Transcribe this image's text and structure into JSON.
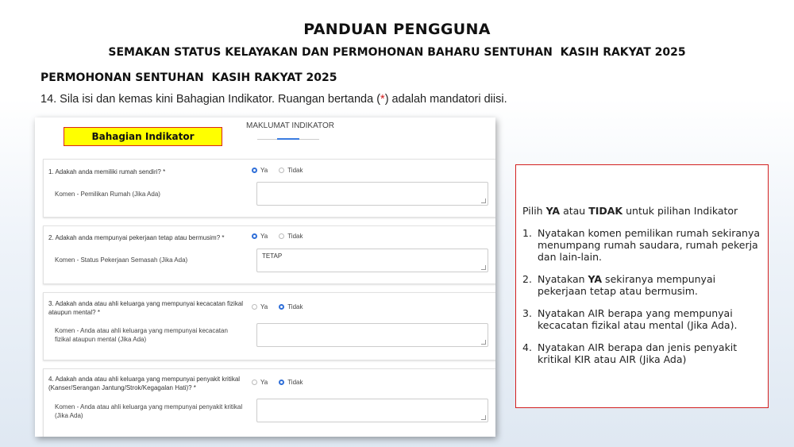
{
  "header": {
    "title": "PANDUAN PENGGUNA",
    "subtitle": "SEMAKAN STATUS KELAYAKAN DAN PERMOHONAN BAHARU SENTUHAN  KASIH RAKYAT 2025"
  },
  "section": {
    "heading": "PERMOHONAN SENTUHAN  KASIH RAKYAT 2025",
    "instruction_before": "14. Sila isi dan kemas kini Bahagian Indikator. Ruangan bertanda (",
    "required_mark": "*",
    "instruction_after": ") adalah mandatori diisi."
  },
  "form": {
    "badge": "Bahagian Indikator",
    "tab_label": "MAKLUMAT INDIKATOR",
    "questions": [
      {
        "question": "1. Adakah anda memiliki rumah sendiri? *",
        "option_yes": "Ya",
        "option_no": "Tidak",
        "selected": "Ya",
        "comment_label": "Komen - Pemilikan Rumah (Jika Ada)",
        "comment_value": ""
      },
      {
        "question": "2. Adakah anda mempunyai pekerjaan tetap atau bermusim? *",
        "option_yes": "Ya",
        "option_no": "Tidak",
        "selected": "Ya",
        "comment_label": "Komen - Status Pekerjaan Semasah (Jika Ada)",
        "comment_value": "TETAP"
      },
      {
        "question": "3. Adakah anda atau ahli keluarga yang mempunyai kecacatan fizikal ataupun mental? *",
        "option_yes": "Ya",
        "option_no": "Tidak",
        "selected": "Tidak",
        "comment_label": "Komen - Anda atau ahli keluarga yang mempunyai kecacatan fizikal ataupun mental (Jika Ada)",
        "comment_value": ""
      },
      {
        "question": "4. Adakah anda atau ahli keluarga yang mempunyai penyakit kritikal (Kanser/Serangan Jantung/Strok/Kegagalan Hati)? *",
        "option_yes": "Ya",
        "option_no": "Tidak",
        "selected": "Tidak",
        "comment_label": "Komen - Anda atau ahli keluarga yang mempunyai penyakit kritikal (Jika Ada)",
        "comment_value": ""
      }
    ]
  },
  "info": {
    "intro_a": "Pilih ",
    "intro_b": "YA",
    "intro_c": " atau ",
    "intro_d": "TIDAK",
    "intro_e": " untuk pilihan Indikator",
    "items": [
      {
        "num": "1.",
        "a": "Nyatakan komen pemilikan rumah sekiranya menumpang rumah saudara, rumah pekerja dan lain-lain.",
        "b": "",
        "c": ""
      },
      {
        "num": "2.",
        "a": "Nyatakan ",
        "b": "YA",
        "c": " sekiranya mempunyai pekerjaan tetap atau bermusim."
      },
      {
        "num": "3.",
        "a": "Nyatakan AIR berapa yang mempunyai kecacatan fizikal atau mental (Jika Ada).",
        "b": "",
        "c": ""
      },
      {
        "num": "4.",
        "a": "Nyatakan AIR berapa dan jenis penyakit kritikal KIR atau AIR (Jika Ada)",
        "b": "",
        "c": ""
      }
    ]
  }
}
